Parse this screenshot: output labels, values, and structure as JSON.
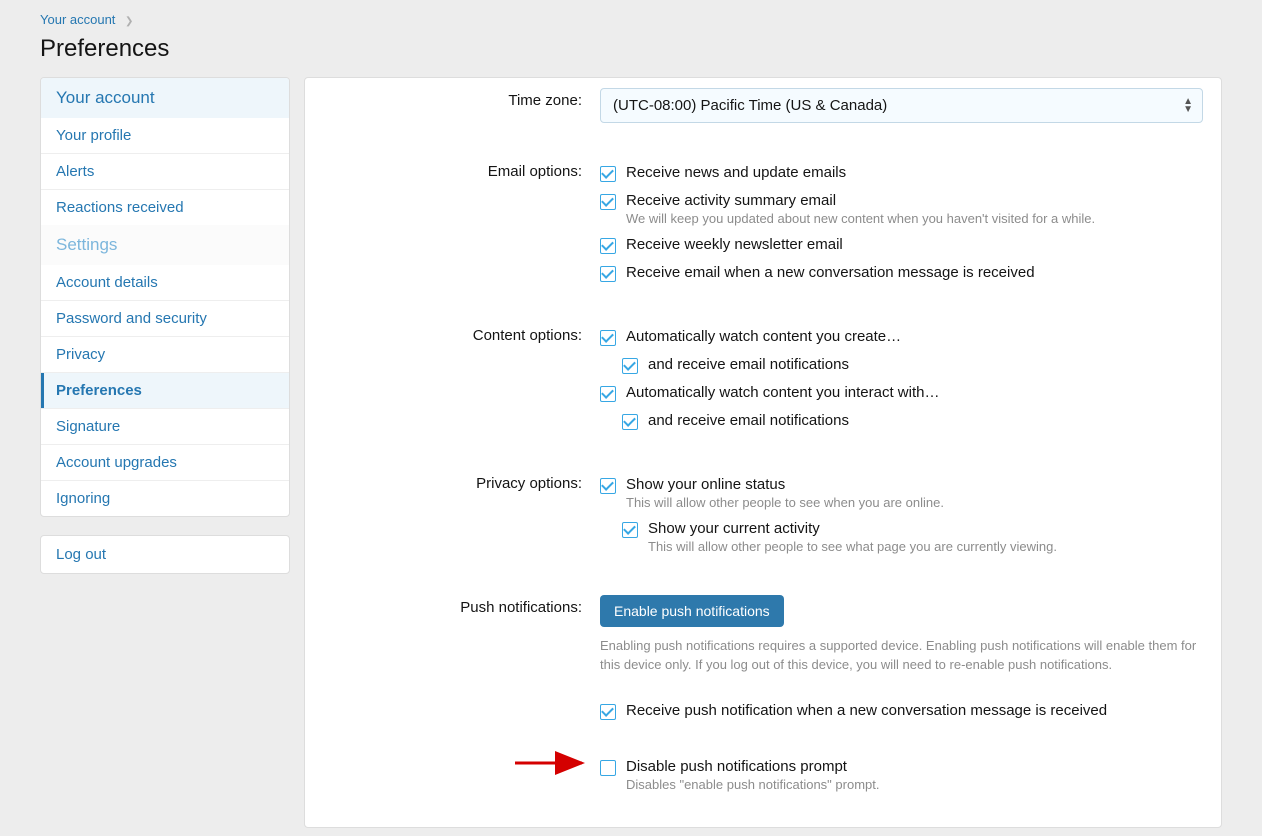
{
  "breadcrumb": {
    "link": "Your account"
  },
  "page_title": "Preferences",
  "sidebar": {
    "section1_title": "Your account",
    "section1_items": [
      "Your profile",
      "Alerts",
      "Reactions received"
    ],
    "section2_title": "Settings",
    "section2_items": [
      "Account details",
      "Password and security",
      "Privacy",
      "Preferences",
      "Signature",
      "Account upgrades",
      "Ignoring"
    ],
    "active_index": 3,
    "logout": "Log out"
  },
  "form": {
    "timezone": {
      "label": "Time zone:",
      "value": "(UTC-08:00) Pacific Time (US & Canada)"
    },
    "email_options": {
      "label": "Email options:",
      "items": [
        {
          "label": "Receive news and update emails",
          "checked": true
        },
        {
          "label": "Receive activity summary email",
          "checked": true,
          "hint": "We will keep you updated about new content when you haven't visited for a while."
        },
        {
          "label": "Receive weekly newsletter email",
          "checked": true
        },
        {
          "label": "Receive email when a new conversation message is received",
          "checked": true
        }
      ]
    },
    "content_options": {
      "label": "Content options:",
      "items": [
        {
          "label": "Automatically watch content you create…",
          "checked": true,
          "sub": {
            "label": "and receive email notifications",
            "checked": true
          }
        },
        {
          "label": "Automatically watch content you interact with…",
          "checked": true,
          "sub": {
            "label": "and receive email notifications",
            "checked": true
          }
        }
      ]
    },
    "privacy_options": {
      "label": "Privacy options:",
      "items": [
        {
          "label": "Show your online status",
          "checked": true,
          "hint": "This will allow other people to see when you are online."
        },
        {
          "label": "Show your current activity",
          "checked": true,
          "hint": "This will allow other people to see what page you are currently viewing.",
          "indent": true
        }
      ]
    },
    "push": {
      "label": "Push notifications:",
      "button": "Enable push notifications",
      "desc": "Enabling push notifications requires a supported device. Enabling push notifications will enable them for this device only. If you log out of this device, you will need to re-enable push notifications.",
      "receive": {
        "label": "Receive push notification when a new conversation message is received",
        "checked": true
      },
      "disable": {
        "label": "Disable push notifications prompt",
        "checked": false,
        "hint": "Disables \"enable push notifications\" prompt."
      }
    }
  }
}
